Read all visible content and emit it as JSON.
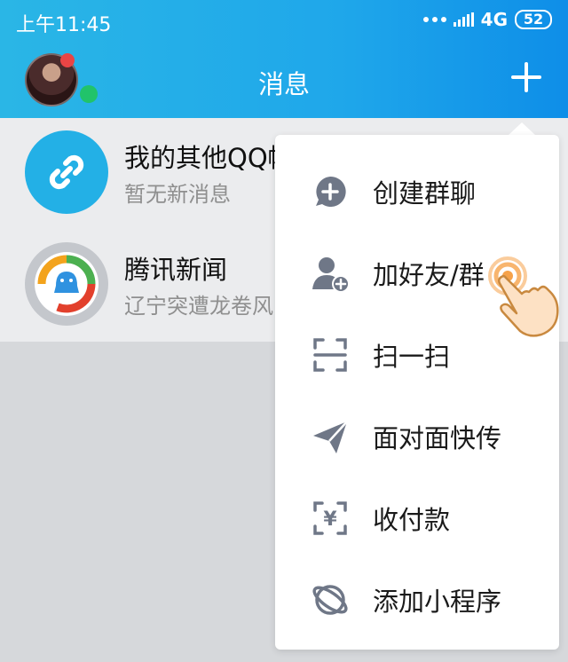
{
  "status_bar": {
    "time": "上午11:45",
    "network": "4G",
    "battery": "52"
  },
  "header": {
    "title": "消息",
    "add_icon": "plus-icon"
  },
  "conversations": [
    {
      "name": "我的其他QQ帐",
      "preview": "暂无新消息",
      "icon": "link-icon"
    },
    {
      "name": "腾讯新闻",
      "preview": "辽宁突遭龙卷风",
      "icon": "tencent-news-logo"
    }
  ],
  "menu": {
    "items": [
      {
        "label": "创建群聊",
        "icon": "create-group-icon"
      },
      {
        "label": "加好友/群",
        "icon": "add-friend-icon"
      },
      {
        "label": "扫一扫",
        "icon": "scan-icon"
      },
      {
        "label": "面对面快传",
        "icon": "send-icon"
      },
      {
        "label": "收付款",
        "icon": "payment-icon"
      },
      {
        "label": "添加小程序",
        "icon": "mini-program-icon"
      }
    ]
  },
  "colors": {
    "header_start": "#2ab6e6",
    "header_end": "#0e8ee8",
    "menu_icon": "#6f7787",
    "online": "#21c36a"
  }
}
